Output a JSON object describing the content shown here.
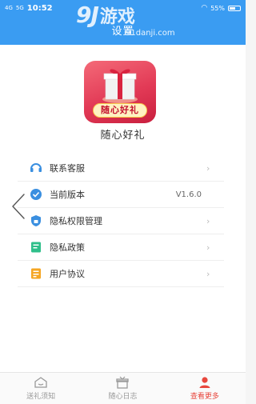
{
  "status_bar": {
    "signal_left": "4G",
    "signal_right": "5G",
    "time": "10:52",
    "battery": "55%"
  },
  "header": {
    "title": "设置"
  },
  "watermark": {
    "brand": "9J",
    "brand_cn": "游戏",
    "url": "91danji.com"
  },
  "app": {
    "icon_label": "随心好礼",
    "name": "随心好礼"
  },
  "menu": {
    "items": [
      {
        "label": "联系客服",
        "icon": "headset-icon",
        "value": ""
      },
      {
        "label": "当前版本",
        "icon": "version-check-icon",
        "value": "V1.6.0"
      },
      {
        "label": "隐私权限管理",
        "icon": "privacy-lock-icon",
        "value": ""
      },
      {
        "label": "隐私政策",
        "icon": "policy-doc-icon",
        "value": ""
      },
      {
        "label": "用户协议",
        "icon": "agreement-doc-icon",
        "value": ""
      }
    ]
  },
  "tabbar": {
    "tabs": [
      {
        "label": "送礼须知",
        "icon": "home-icon",
        "active": false
      },
      {
        "label": "随心日志",
        "icon": "gift-box-icon",
        "active": false
      },
      {
        "label": "查看更多",
        "icon": "person-icon",
        "active": true
      }
    ]
  },
  "colors": {
    "header_blue": "#3a9cf2",
    "active_red": "#e8473d"
  }
}
